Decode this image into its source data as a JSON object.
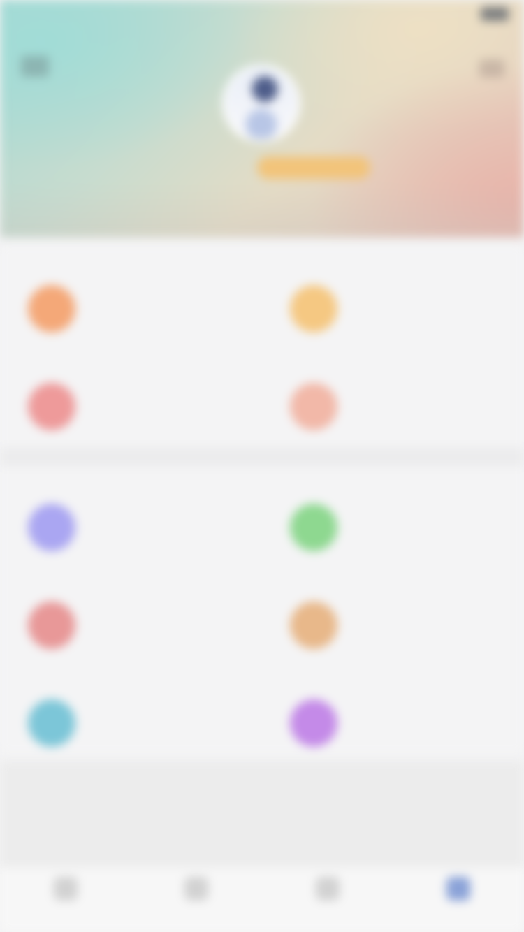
{
  "status_bar": {
    "carrier": "",
    "time": "",
    "battery": ""
  },
  "profile": {
    "name": "",
    "vip_badge": "",
    "subtitle": ""
  },
  "section_1": {
    "items": [
      {
        "title": "",
        "desc": "",
        "icon": "orange-circle-icon",
        "color": "#f4a878"
      },
      {
        "title": "",
        "desc": "",
        "icon": "yellow-circle-icon",
        "color": "#f5c882"
      },
      {
        "title": "",
        "desc": "",
        "icon": "red-circle-icon",
        "color": "#ee9a9a"
      },
      {
        "title": "",
        "desc": "",
        "icon": "peach-circle-icon",
        "color": "#f2b8a8"
      }
    ]
  },
  "section_2": {
    "items": [
      {
        "title": "",
        "desc": "",
        "icon": "purple-circle-icon",
        "color": "#aaa6f2"
      },
      {
        "title": "",
        "desc": "",
        "icon": "green-circle-icon",
        "color": "#8ed890"
      },
      {
        "title": "",
        "desc": "",
        "icon": "red-circle-icon",
        "color": "#e89898"
      },
      {
        "title": "",
        "desc": "",
        "icon": "tan-circle-icon",
        "color": "#e8b88a"
      },
      {
        "title": "",
        "desc": "",
        "icon": "cyan-circle-icon",
        "color": "#7cc6d8"
      },
      {
        "title": "",
        "desc": "",
        "icon": "violet-circle-icon",
        "color": "#c48ae8"
      }
    ]
  },
  "tab_bar": {
    "tabs": [
      {
        "label": "",
        "icon": "home-icon",
        "active": false
      },
      {
        "label": "",
        "icon": "discover-icon",
        "active": false
      },
      {
        "label": "",
        "icon": "message-icon",
        "active": false
      },
      {
        "label": "",
        "icon": "profile-icon",
        "active": true
      }
    ]
  },
  "colors": {
    "header_teal": "#a8d8d2",
    "header_sand": "#e4dcc6",
    "header_rose": "#e6c5b9",
    "vip_gold": "#f2c47a",
    "active_tab": "#6f88c8"
  }
}
